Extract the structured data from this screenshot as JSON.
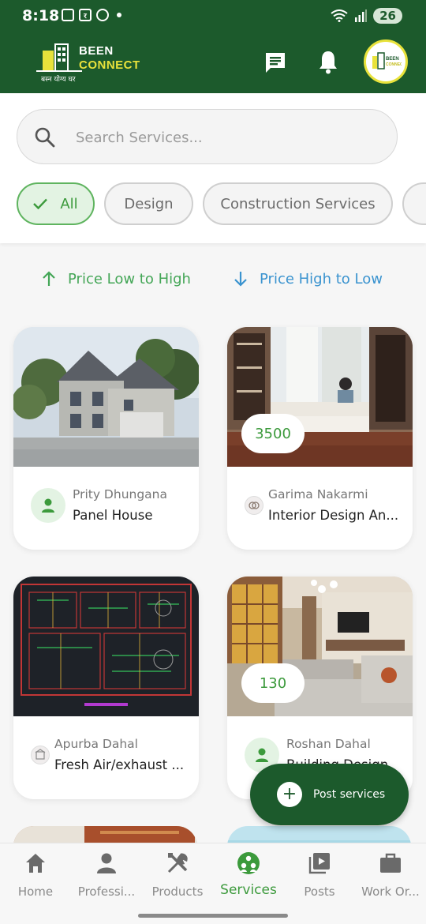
{
  "status_bar": {
    "time": "8:18",
    "icon_r": "र",
    "battery": "26"
  },
  "header": {
    "logo_line1": "BEEN",
    "logo_line2": "CONNECT",
    "logo_tagline": "बस्न योग्य घर",
    "chat_icon": "chat-icon",
    "bell_icon": "bell-icon",
    "profile_icon": "profile-avatar-icon"
  },
  "search": {
    "placeholder": "Search Services..."
  },
  "filters": [
    {
      "label": "All",
      "active": true
    },
    {
      "label": "Design",
      "active": false
    },
    {
      "label": "Construction Services",
      "active": false
    }
  ],
  "sort": {
    "low_label": "Price Low to High",
    "high_label": "Price High to Low"
  },
  "colors": {
    "primary": "#1c5a2c",
    "accent_green": "#3c9a3c",
    "accent_blue": "#3a93cf",
    "brand_yellow": "#e8e23b"
  },
  "services": [
    {
      "provider": "Prity Dhungana",
      "title": "Panel House",
      "price": null,
      "image": "two-story-house"
    },
    {
      "provider": "Garima Nakarmi",
      "title": "Interior Design An...",
      "price": "3500",
      "image": "window-seat-interior"
    },
    {
      "provider": "Apurba Dahal",
      "title": "Fresh Air/exhaust ...",
      "price": null,
      "image": "basement-floor-plan"
    },
    {
      "provider": "Roshan Dahal",
      "title": "Building Design",
      "price": "130",
      "image": "living-room-interior"
    }
  ],
  "fab": {
    "label": "Post services"
  },
  "bottom_nav": [
    {
      "label": "Home",
      "icon": "home-icon"
    },
    {
      "label": "Professi...",
      "icon": "person-icon"
    },
    {
      "label": "Products",
      "icon": "tools-icon"
    },
    {
      "label": "Services",
      "icon": "services-icon",
      "active": true
    },
    {
      "label": "Posts",
      "icon": "video-library-icon"
    },
    {
      "label": "Work Or...",
      "icon": "briefcase-icon"
    }
  ]
}
